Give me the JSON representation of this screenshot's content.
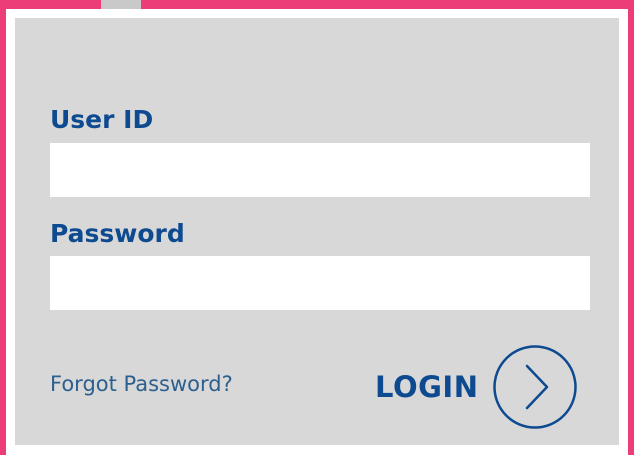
{
  "form": {
    "user_id_label": "User ID",
    "user_id_value": "",
    "password_label": "Password",
    "password_value": "",
    "forgot_link": "Forgot Password?",
    "login_label": "LOGIN",
    "login_icon": "chevron-right-circle-icon"
  },
  "colors": {
    "frame": "#ec3d78",
    "panel": "#d8d8d8",
    "label_text": "#0d4a8f",
    "link_text": "#2c5f8e",
    "field_bg": "#ffffff"
  }
}
